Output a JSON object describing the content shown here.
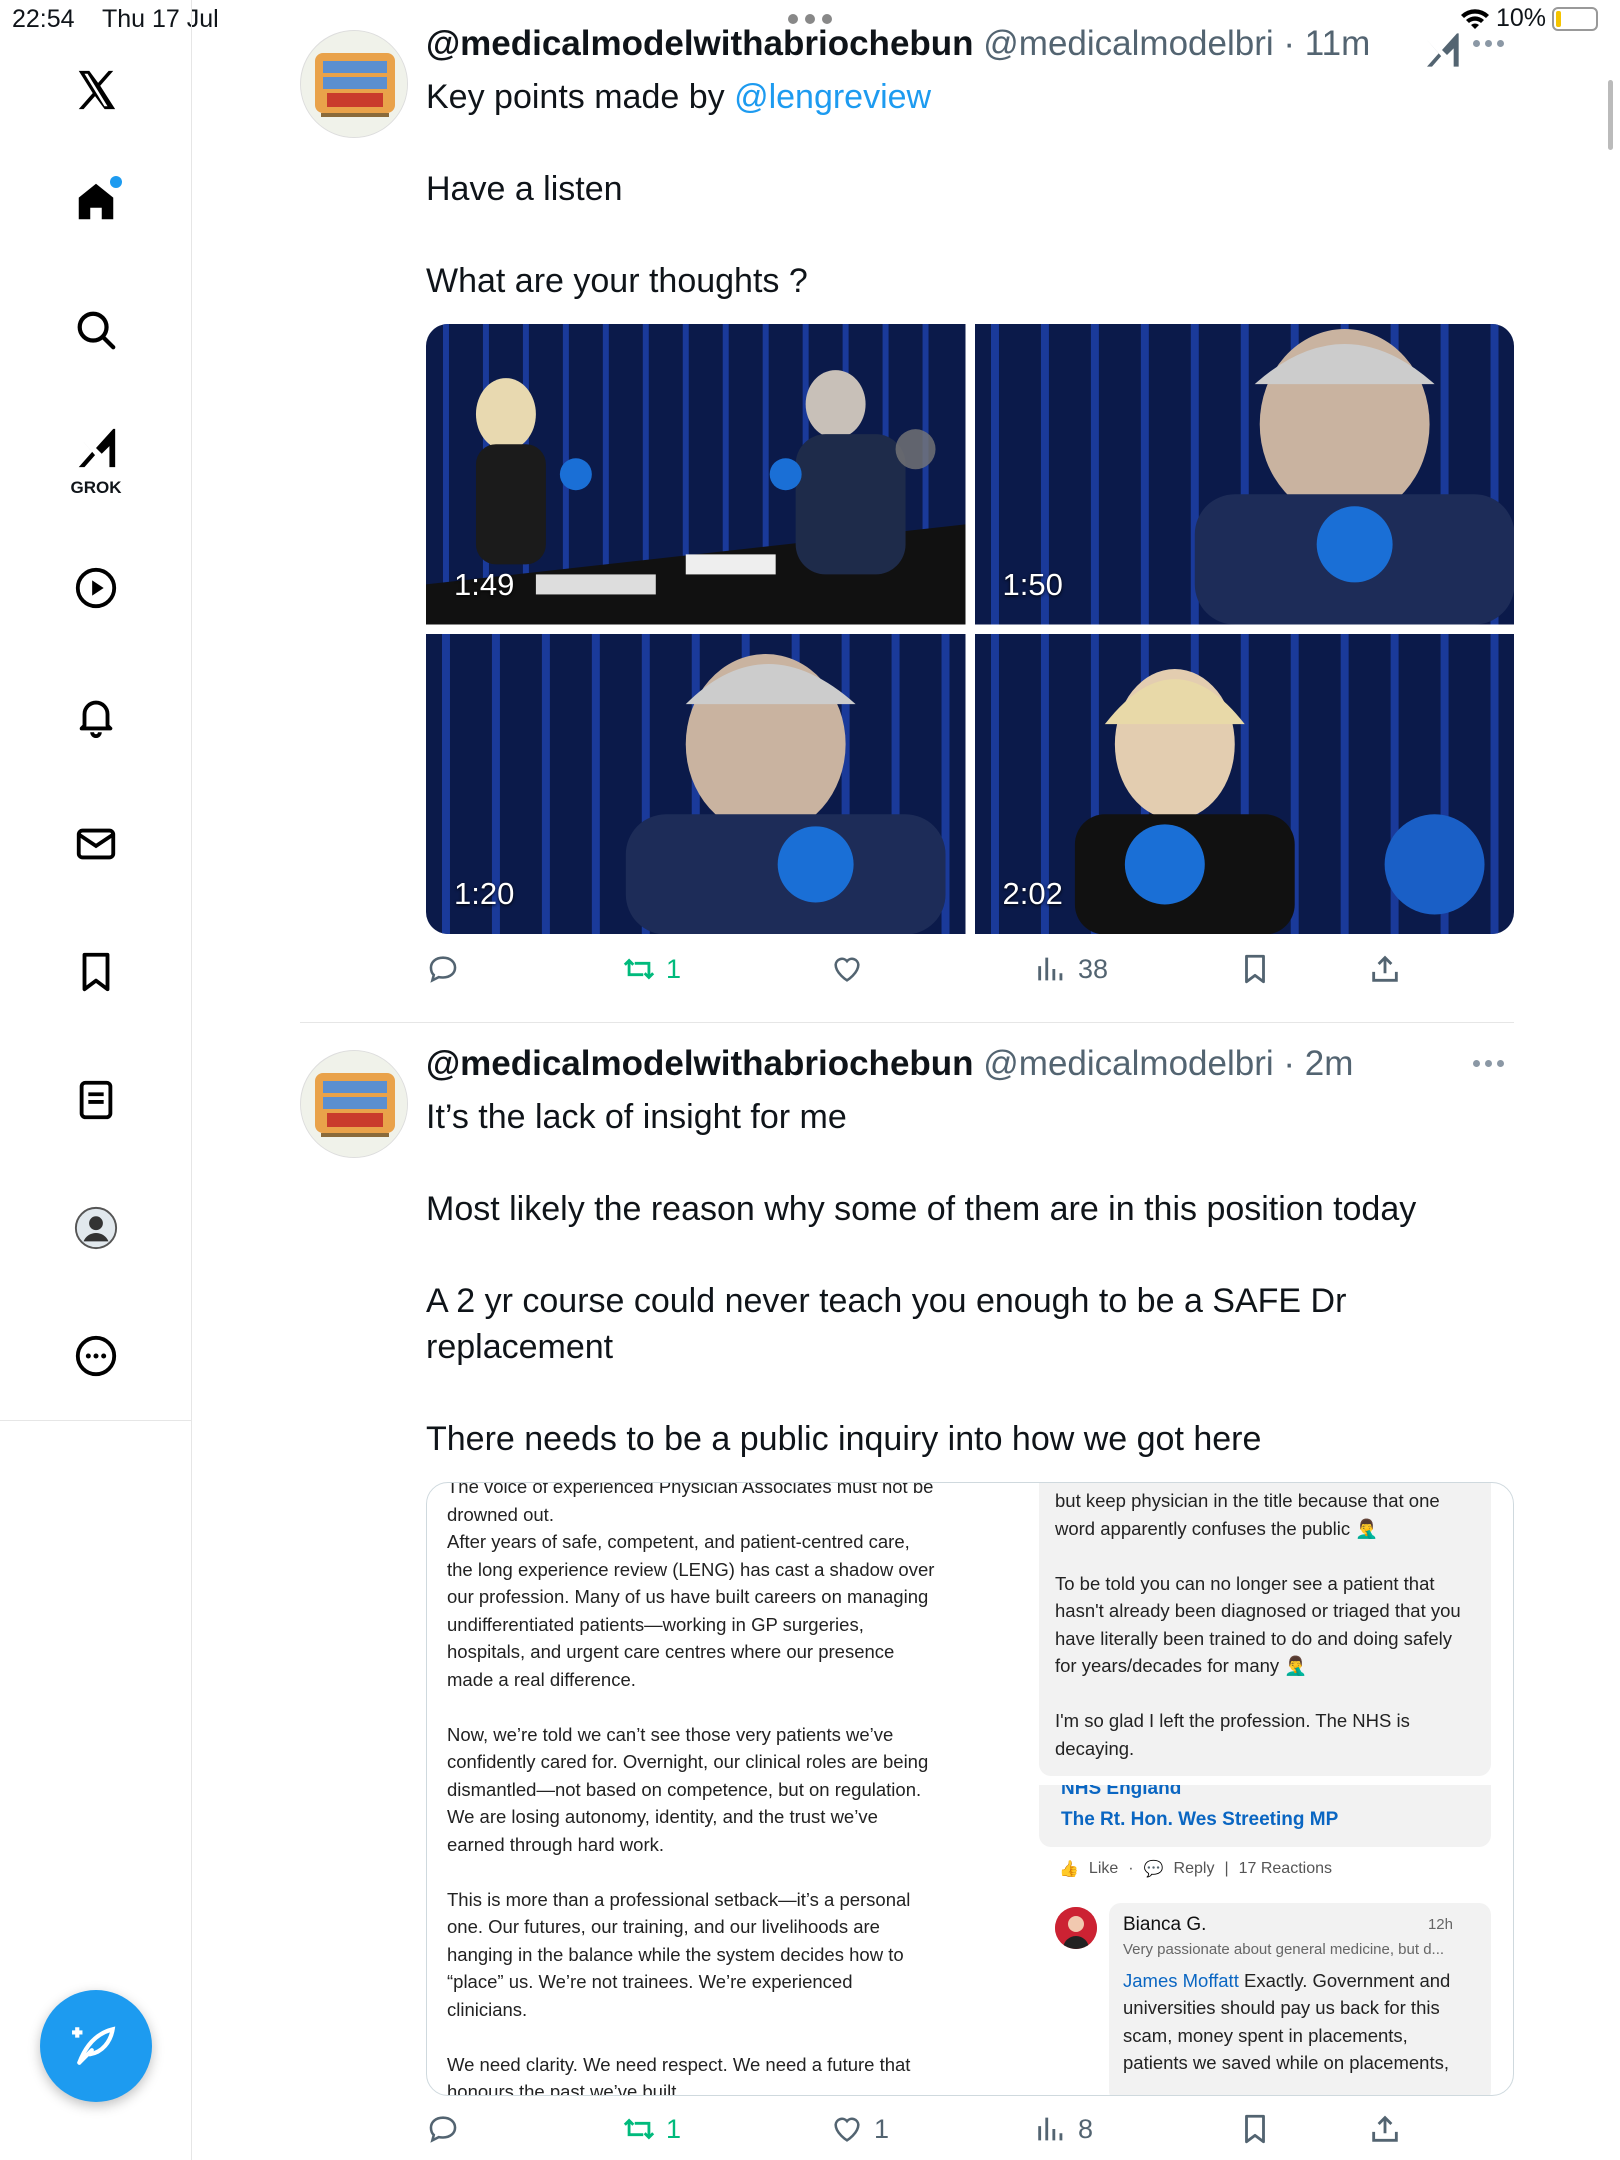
{
  "status_bar": {
    "time": "22:54",
    "date": "Thu 17 Jul",
    "battery": "10%"
  },
  "sidebar": {
    "grok_label": "GROK"
  },
  "tweets": [
    {
      "name": "@medicalmodelwithabriochebun",
      "handle": "@medicalmodelbri",
      "time": "11m",
      "text_prefix": "Key points made by ",
      "mention": "@lengreview",
      "para2": "Have a listen",
      "para3": "What are your thoughts ?",
      "videos": [
        {
          "duration": "1:49"
        },
        {
          "duration": "1:50"
        },
        {
          "duration": "1:20"
        },
        {
          "duration": "2:02"
        }
      ],
      "retweets": "1",
      "views": "38"
    },
    {
      "name": "@medicalmodelwithabriochebun",
      "handle": "@medicalmodelbri",
      "time": "2m",
      "p1": "It’s the lack of insight for me",
      "p2": "Most likely the reason why some of them are in this position today",
      "p3": "A 2 yr course could never teach you enough to be a SAFE Dr replacement",
      "p4": "There needs to be a public inquiry into how we got here",
      "quote": {
        "left_lines": [
          "The voice of experienced Physician Associates must not be",
          "drowned out.",
          "After years of safe, competent, and patient-centred care,",
          "the long experience review (LENG) has cast a shadow over",
          "our profession. Many of us have built careers on managing",
          "undifferentiated patients—working in GP surgeries,",
          "hospitals, and urgent care centres where our presence",
          "made a real difference.",
          "",
          "Now, we’re told we can’t see those very patients we’ve",
          "confidently cared for. Overnight, our clinical roles are being",
          "dismantled—not based on competence, but on regulation.",
          "We are losing autonomy, identity, and the trust we’ve",
          "earned through hard work.",
          "",
          "This is more than a professional setback—it’s a personal",
          "one. Our futures, our training, and our livelihoods are",
          "hanging in the balance while the system decides how to",
          "“place” us. We’re not trainees. We’re experienced",
          "clinicians.",
          "",
          "We need clarity. We need respect. We need a future that",
          "honours the past we’ve built."
        ],
        "right_lines": [
          "but keep physician in the title because that one",
          "word apparently confuses the public 🤦‍♂",
          "",
          "To be told you can no longer see a patient that",
          "hasn't already been diagnosed or triaged that you",
          "have literally been trained to do and doing safely",
          "for years/decades for many 🤦‍♂",
          "",
          "I'm so glad I left the profession. The NHS is",
          "decaying."
        ],
        "link1": "NHS England",
        "link2": "The Rt. Hon. Wes Streeting MP",
        "like": "Like",
        "reply": "Reply",
        "reactions": "17 Reactions",
        "commenter": "Bianca G.",
        "comment_time": "12h",
        "commenter_bio": "Very passionate about general medicine, but d...",
        "comment_mention": "James Moffatt",
        "comment_lines": [
          " Exactly. Government and",
          "universities should pay us back for this",
          "scam, money spent in placements,",
          "patients we saved while on placements,"
        ]
      },
      "retweets": "1",
      "likes": "1",
      "views": "8"
    }
  ]
}
